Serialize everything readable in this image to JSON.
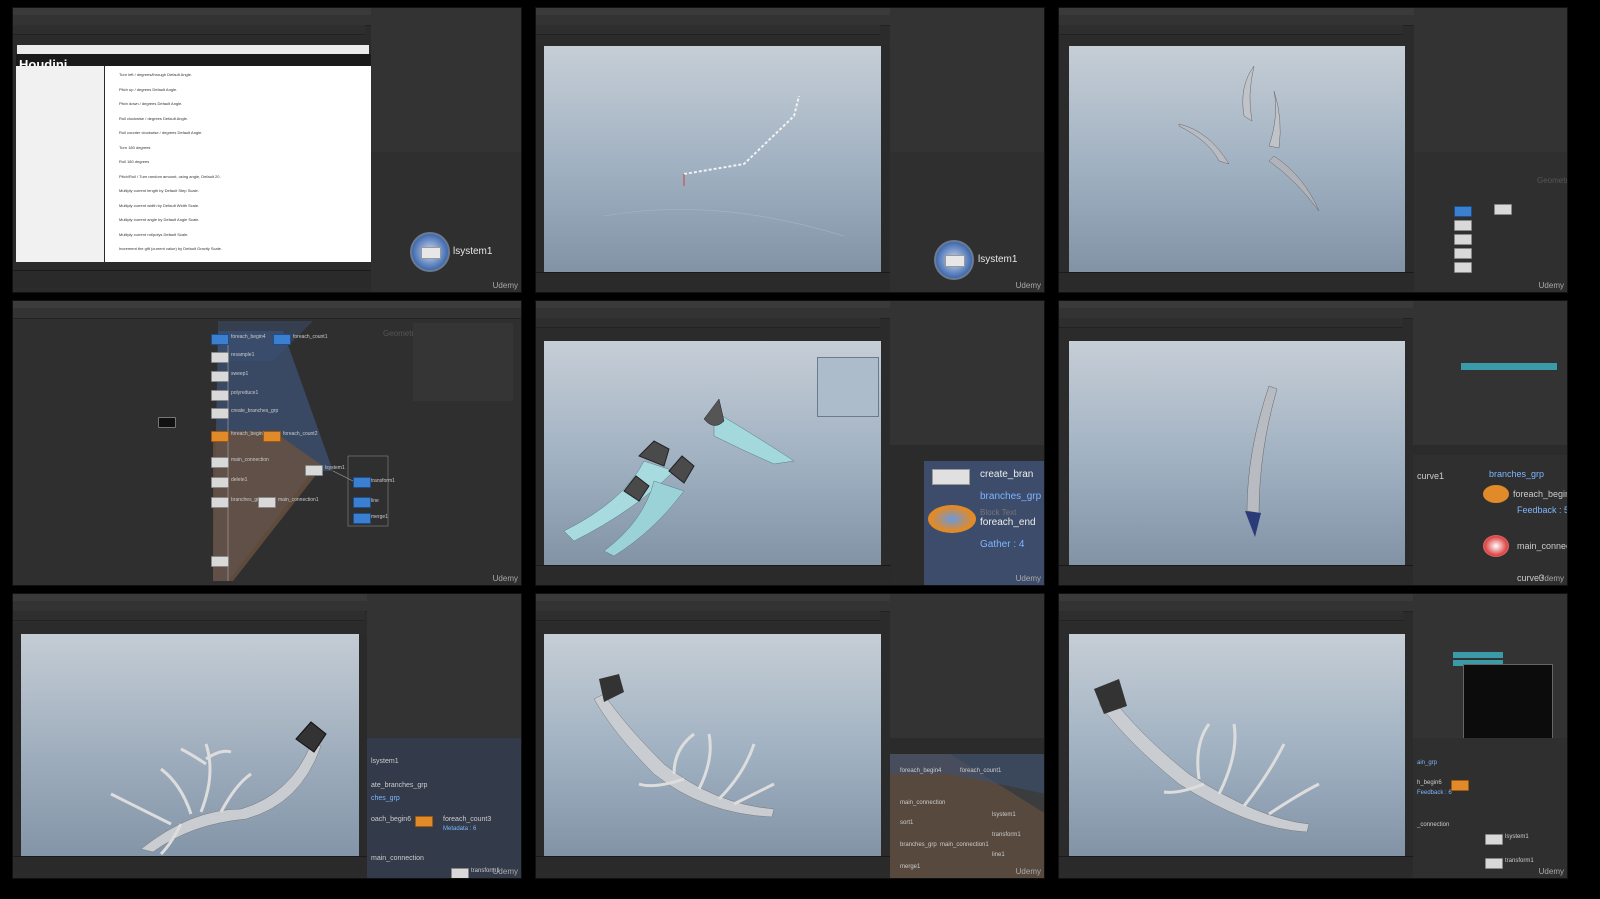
{
  "watermark": "Udemy",
  "thumbs": [
    {
      "id": "t1",
      "app_logo": "Houdini",
      "node_label": "lsystem1",
      "doc_lines": [
        "Turn left / degrees/through Default Angle.",
        "Pitch up / degrees Default Angle.",
        "Pitch down / degrees Default Angle.",
        "Roll clockwise / degrees Default Angle.",
        "Roll counter clockwise / degrees Default Angle.",
        "Turn 180 degrees",
        "Roll 180 degrees",
        "Pitch/Roll / Turn random amount, using angle, Default 20.",
        "Multiply current length by Default Step Scale.",
        "Multiply current width by Default Width Scale.",
        "Multiply current angle by Default Angle Scale.",
        "Multiply current rot/polys Default Scale.",
        "Increment the gift (current value) by Default Gravity Scale."
      ]
    },
    {
      "id": "t2",
      "node_label": "lsystem1"
    },
    {
      "id": "t3",
      "network_label": "Geometry"
    },
    {
      "id": "t4",
      "network_label": "Geometry",
      "nodes": [
        "foreach_begin4",
        "foreach_count1",
        "resample1",
        "sweep1",
        "polyreduce1",
        "create_branches_grp",
        "foreach_begin5",
        "foreach_count2",
        "main_connection",
        "delete1",
        "branches_grp",
        "main_connection1",
        "lsystem1",
        "transform1",
        "line",
        "merge1"
      ]
    },
    {
      "id": "t5",
      "nodes": [
        {
          "label": "create_bran",
          "style": "plain"
        },
        {
          "label": "branches_grp",
          "style": "blue-text"
        },
        {
          "label": "Block Text",
          "style": "dim"
        },
        {
          "label": "foreach_end",
          "style": "plain"
        },
        {
          "label": "Gather : 4",
          "style": "blue-text"
        }
      ]
    },
    {
      "id": "t6",
      "nodes": [
        {
          "label": "curve1",
          "style": "plain"
        },
        {
          "label": "branches_grp",
          "style": "blue-text"
        },
        {
          "label": "foreach_begin",
          "style": "plain"
        },
        {
          "label": "Feedback : 5",
          "style": "blue-text"
        },
        {
          "label": "main_connec",
          "style": "plain"
        },
        {
          "label": "curve3",
          "style": "plain"
        }
      ]
    },
    {
      "id": "t7",
      "nodes": [
        {
          "label": "lsystem1",
          "style": "plain"
        },
        {
          "label": "ate_branches_grp",
          "style": "plain"
        },
        {
          "label": "ches_grp",
          "style": "blue-text"
        },
        {
          "label": "oach_begin6",
          "style": "plain"
        },
        {
          "label": "foreach_count3",
          "style": "plain"
        },
        {
          "label": "Metadata : 6",
          "style": "blue-text"
        },
        {
          "label": "main_connection",
          "style": "plain"
        },
        {
          "label": "transform1",
          "style": "plain"
        }
      ]
    },
    {
      "id": "t8",
      "nodes": [
        {
          "label": "foreach_begin4",
          "style": "plain"
        },
        {
          "label": "foreach_count1",
          "style": "plain"
        },
        {
          "label": "main_connection",
          "style": "plain"
        },
        {
          "label": "lsystem1",
          "style": "plain"
        },
        {
          "label": "sort1",
          "style": "plain"
        },
        {
          "label": "transform1",
          "style": "plain"
        },
        {
          "label": "branches_grp",
          "style": "plain"
        },
        {
          "label": "main_connection1",
          "style": "plain"
        },
        {
          "label": "line1",
          "style": "plain"
        },
        {
          "label": "merge1",
          "style": "plain"
        }
      ]
    },
    {
      "id": "t9",
      "nodes": [
        {
          "label": "ain_grp",
          "style": "blue-text"
        },
        {
          "label": "h_begin6",
          "style": "plain"
        },
        {
          "label": "Feedback : 6",
          "style": "blue-text"
        },
        {
          "label": "_connection",
          "style": "plain"
        },
        {
          "label": "lsystem1",
          "style": "plain"
        },
        {
          "label": "transform1",
          "style": "plain"
        }
      ]
    }
  ]
}
